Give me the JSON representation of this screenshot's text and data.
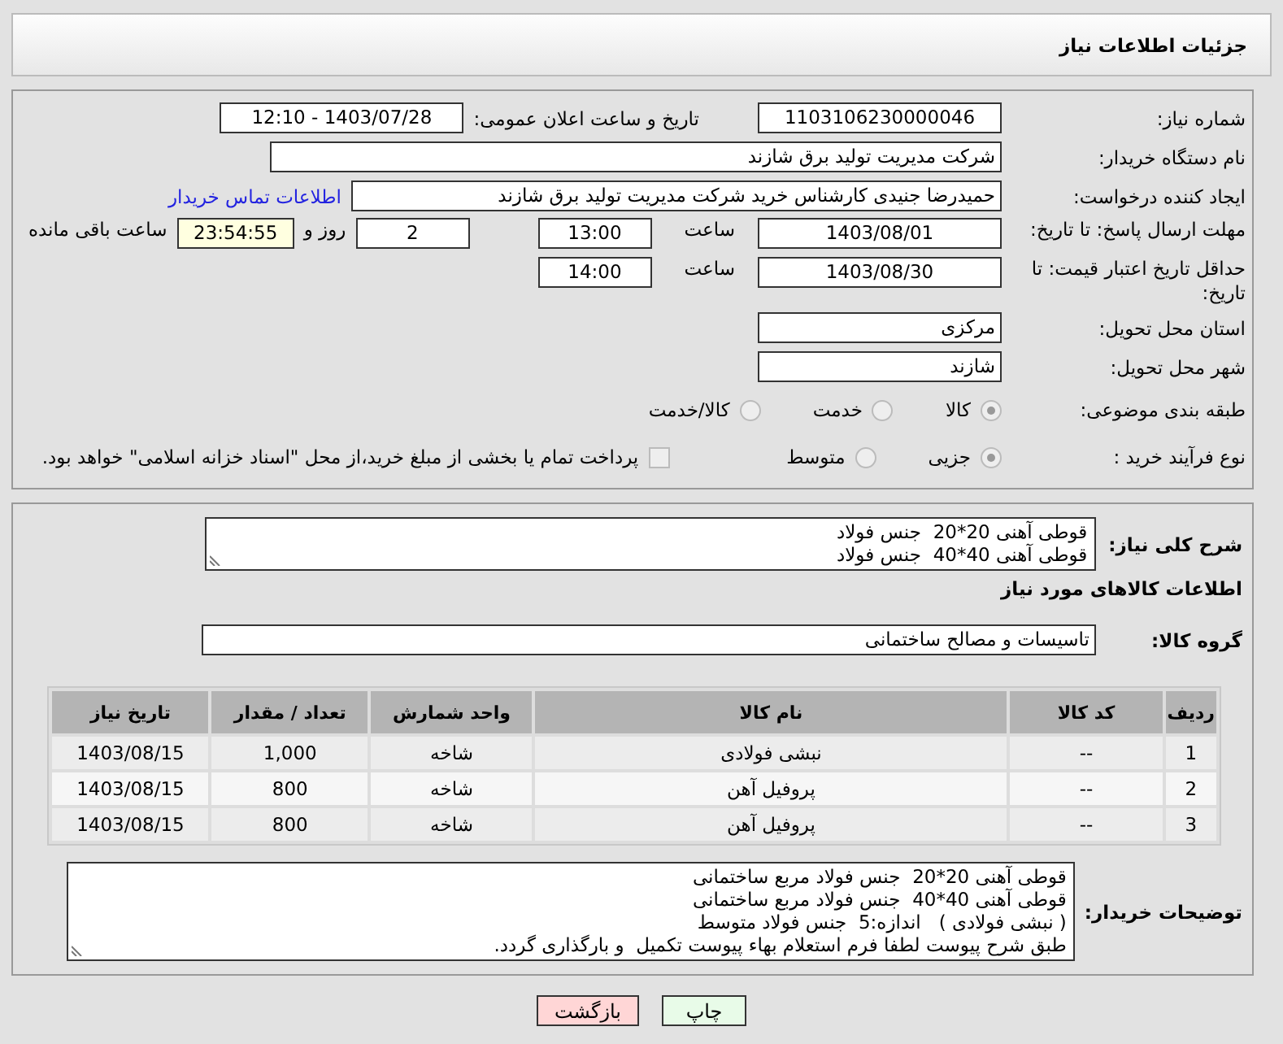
{
  "header": {
    "title": "جزئیات اطلاعات نیاز"
  },
  "info": {
    "need_number": {
      "label": "شماره نیاز:",
      "value": "1103106230000046"
    },
    "announce": {
      "label": "تاریخ و ساعت اعلان عمومی:",
      "value": "1403/07/28 - 12:10"
    },
    "buyer_org": {
      "label": "نام دستگاه خریدار:",
      "value": "شرکت مدیریت تولید برق شازند"
    },
    "requester": {
      "label": "ایجاد کننده درخواست:",
      "value": "حمیدرضا جنیدی کارشناس خرید شرکت مدیریت تولید برق شازند",
      "link": "اطلاعات تماس خریدار"
    },
    "deadline": {
      "label": "مهلت ارسال پاسخ: تا تاریخ:",
      "date": "1403/08/01",
      "time_label": "ساعت",
      "time": "13:00",
      "days": "2",
      "days_label": "روز و",
      "remaining": "23:54:55",
      "remaining_label": "ساعت باقی مانده"
    },
    "validity": {
      "label": "حداقل تاریخ اعتبار قیمت: تا تاریخ:",
      "date": "1403/08/30",
      "time_label": "ساعت",
      "time": "14:00"
    },
    "province": {
      "label": "استان محل تحویل:",
      "value": "مرکزی"
    },
    "city": {
      "label": "شهر محل تحویل:",
      "value": "شازند"
    },
    "category": {
      "label": "طبقه بندی موضوعی:",
      "options": [
        {
          "label": "کالا",
          "selected": true
        },
        {
          "label": "خدمت",
          "selected": false
        },
        {
          "label": "کالا/خدمت",
          "selected": false
        }
      ]
    },
    "process": {
      "label": "نوع فرآیند خرید :",
      "options": [
        {
          "label": "جزیی",
          "selected": true
        },
        {
          "label": "متوسط",
          "selected": false
        }
      ],
      "payment": {
        "label": "پرداخت تمام یا بخشی از مبلغ خرید،از محل \"اسناد خزانه اسلامی\" خواهد بود.",
        "checked": false
      }
    }
  },
  "goods": {
    "description": {
      "label": "شرح کلی نیاز:",
      "lines": [
        "قوطی آهنی 20*20  جنس فولاد",
        "قوطی آهنی 40*40  جنس فولاد"
      ]
    },
    "title": "اطلاعات کالاهای مورد نیاز",
    "group": {
      "label": "گروه کالا:",
      "value": "تاسیسات و مصالح ساختمانی"
    },
    "table": {
      "columns": [
        "ردیف",
        "کد کالا",
        "نام کالا",
        "واحد شمارش",
        "تعداد / مقدار",
        "تاریخ نیاز"
      ],
      "rows": [
        [
          "1",
          "--",
          "نبشی فولادی",
          "شاخه",
          "1,000",
          "1403/08/15"
        ],
        [
          "2",
          "--",
          "پروفیل آهن",
          "شاخه",
          "800",
          "1403/08/15"
        ],
        [
          "3",
          "--",
          "پروفیل آهن",
          "شاخه",
          "800",
          "1403/08/15"
        ]
      ]
    },
    "notes": {
      "label": "توضیحات خریدار:",
      "lines": [
        "قوطی آهنی 20*20  جنس فولاد مربع ساختمانی",
        "قوطی آهنی 40*40  جنس فولاد مربع ساختمانی",
        "( نبشی فولادی )   اندازه:5  جنس فولاد متوسط",
        "طبق شرح پیوست لطفا فرم استعلام بهاء پیوست تکمیل  و بارگذاری گردد."
      ]
    }
  },
  "buttons": [
    {
      "label": "چاپ",
      "kind": "print"
    },
    {
      "label": "بازگشت",
      "kind": "back"
    }
  ]
}
